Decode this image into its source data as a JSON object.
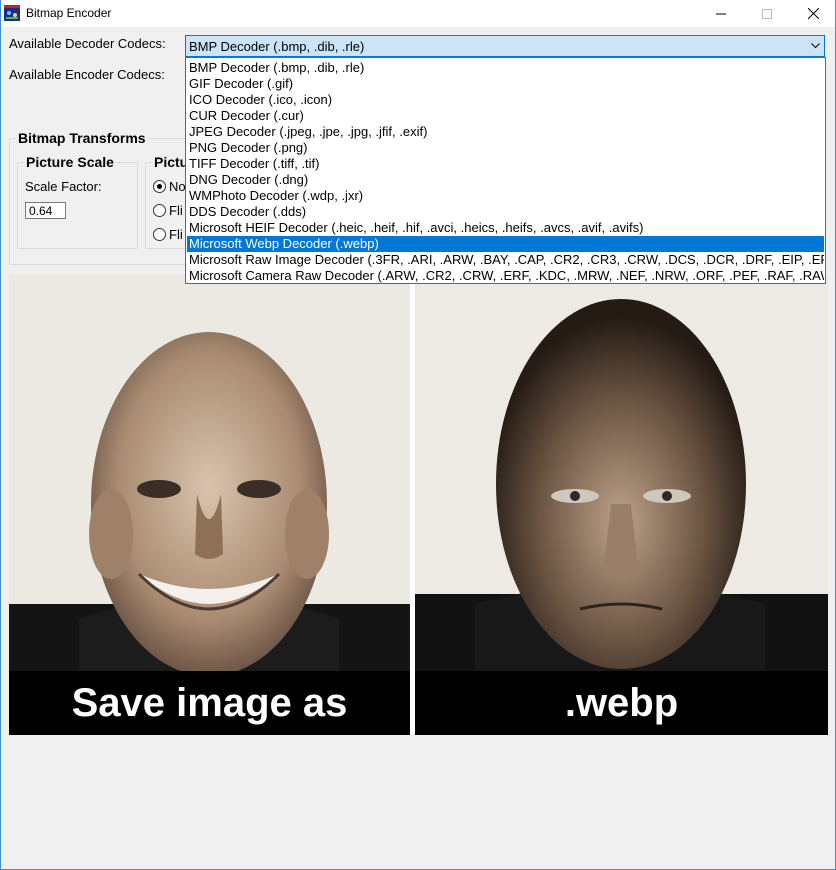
{
  "window": {
    "title": "Bitmap Encoder"
  },
  "decoder": {
    "label": "Available Decoder Codecs:",
    "selected": "BMP Decoder (.bmp, .dib, .rle)",
    "options": [
      "BMP Decoder (.bmp, .dib, .rle)",
      "GIF Decoder (.gif)",
      "ICO Decoder (.ico, .icon)",
      "CUR Decoder (.cur)",
      "JPEG Decoder (.jpeg, .jpe, .jpg, .jfif, .exif)",
      "PNG Decoder (.png)",
      "TIFF Decoder (.tiff, .tif)",
      "DNG Decoder (.dng)",
      "WMPhoto Decoder (.wdp, .jxr)",
      "DDS Decoder (.dds)",
      "Microsoft HEIF Decoder (.heic, .heif, .hif, .avci, .heics, .heifs, .avcs, .avif, .avifs)",
      "Microsoft Webp Decoder (.webp)",
      "Microsoft Raw Image Decoder (.3FR, .ARI, .ARW, .BAY, .CAP, .CR2, .CR3, .CRW, .DCS, .DCR, .DRF, .EIP, .ERF",
      "Microsoft Camera Raw Decoder (.ARW, .CR2, .CRW, .ERF, .KDC, .MRW, .NEF, .NRW, .ORF, .PEF, .RAF, .RAW"
    ],
    "highlighted_index": 11
  },
  "encoder": {
    "label": "Available Encoder Codecs:"
  },
  "transforms": {
    "title": "Bitmap Transforms",
    "scale": {
      "title": "Picture Scale",
      "factor_label": "Scale Factor:",
      "factor_value": "0.64"
    },
    "picture_group": {
      "title_visible": "Pictu",
      "options": [
        "No",
        "Fli",
        "Fli"
      ],
      "checked_index": 0
    }
  },
  "picture": {
    "left_caption": "Save image as",
    "right_caption": ".webp"
  }
}
